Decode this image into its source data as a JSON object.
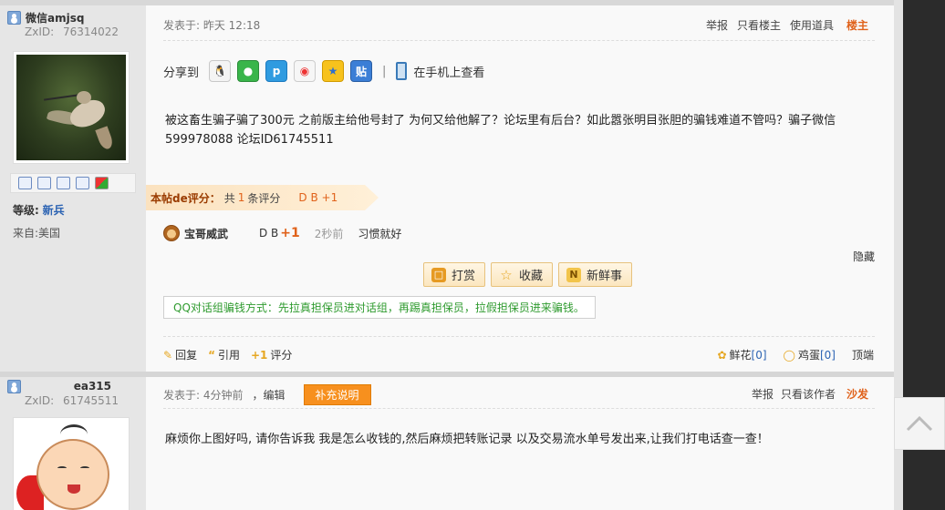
{
  "post1": {
    "user": {
      "name": "微信amjsq",
      "zxid_label": "ZxID:",
      "zxid": "76314022",
      "level_label": "等级:",
      "level": "新兵",
      "from": "来自:美国"
    },
    "meta": {
      "posted": "发表于: 昨天 12:18"
    },
    "actions": {
      "report": "举报",
      "only_author": "只看楼主",
      "use_tool": "使用道具",
      "floor": "楼主"
    },
    "share": {
      "label": "分享到",
      "mobile": "在手机上查看",
      "icons": [
        "qq-icon",
        "wechat-icon",
        "pp-icon",
        "weibo-icon",
        "qzone-icon",
        "tieba-icon"
      ]
    },
    "body": "被这畜生骗子骗了300元  之前版主给他号封了 为何又给他解了？论坛里有后台？如此嚣张明目张胆的骗钱难道不管吗？骗子微信599978088  论坛ID61745511",
    "rating": {
      "label": "本帖de评分：",
      "count_prefix": "共",
      "count": "1",
      "count_suffix": "条评分",
      "score": "D B  +1"
    },
    "rater": {
      "name": "宝哥威武",
      "db": "D B",
      "plus": "+1",
      "time": "2秒前",
      "reason": "习惯就好"
    },
    "hide": "隐藏",
    "buttons": {
      "tip": "打赏",
      "fav": "收藏",
      "fresh": "新鲜事"
    },
    "notice": "QQ对话组骗钱方式：先拉真担保员进对话组，再踢真担保员，拉假担保员进来骗钱。",
    "footer": {
      "reply": "回复",
      "quote": "引用",
      "rate": "评分",
      "flower": "鲜花",
      "flower_count": "[0]",
      "egg": "鸡蛋",
      "egg_count": "[0]",
      "top": "顶端"
    }
  },
  "post2": {
    "user": {
      "name": "ea315",
      "zxid_label": "ZxID:",
      "zxid": "61745511"
    },
    "meta": {
      "posted": "发表于: 4分钟前",
      "edit": "，编辑",
      "supplement": "补充说明"
    },
    "actions": {
      "report": "举报",
      "only_author": "只看该作者",
      "floor": "沙发"
    },
    "body": "麻烦你上图好吗, 请你告诉我 我是怎么收钱的,然后麻烦把转账记录 以及交易流水单号发出来,让我们打电话查一查！"
  }
}
